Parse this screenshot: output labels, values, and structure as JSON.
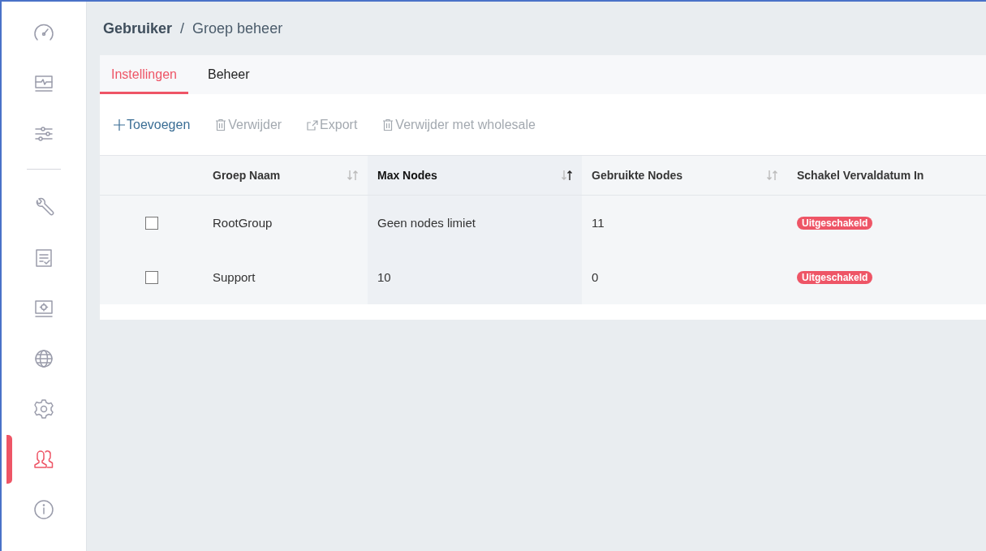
{
  "sidebar": {
    "items": [
      {
        "kind": "button",
        "selected": false
      },
      {
        "kind": "button",
        "selected": false
      },
      {
        "kind": "button",
        "selected": false
      },
      {
        "kind": "divider"
      },
      {
        "kind": "button",
        "selected": false
      },
      {
        "kind": "button",
        "selected": false
      },
      {
        "kind": "button",
        "selected": false
      },
      {
        "kind": "button",
        "selected": false
      },
      {
        "kind": "button",
        "selected": false
      },
      {
        "kind": "button",
        "selected": true
      },
      {
        "kind": "button",
        "selected": false
      }
    ]
  },
  "breadcrumb": [
    {
      "label": "Gebruiker",
      "current": false
    },
    {
      "label": "Groep beheer",
      "current": true
    }
  ],
  "breadcrumb_separator": "/",
  "tabs": [
    {
      "label": "Instellingen",
      "selected": true
    },
    {
      "label": "Beheer",
      "selected": false
    }
  ],
  "toolbar": [
    {
      "label": "Toevoegen",
      "kind": "add",
      "disabled": false
    },
    {
      "label": "Verwijder",
      "kind": "delete",
      "disabled": true
    },
    {
      "label": "Export",
      "kind": "export",
      "disabled": true
    },
    {
      "label": "Verwijder met wholesale",
      "kind": "delete",
      "disabled": true
    }
  ],
  "table": {
    "columns": [
      {
        "label": "Groep Naam",
        "sortable": true,
        "sorted": false
      },
      {
        "label": "Max Nodes",
        "sortable": true,
        "sorted": true
      },
      {
        "label": "Gebruikte Nodes",
        "sortable": true,
        "sorted": false
      },
      {
        "label": "Schakel Vervaldatum In",
        "sortable": false,
        "sorted": false
      }
    ],
    "rows": [
      {
        "checked": false,
        "cells": [
          "RootGroup",
          "Geen nodes limiet",
          "11"
        ],
        "status": "Uitgeschakeld",
        "enabled": false
      },
      {
        "checked": false,
        "cells": [
          "Support",
          "10",
          "0"
        ],
        "status": "Uitgeschakeld",
        "enabled": false
      }
    ]
  }
}
